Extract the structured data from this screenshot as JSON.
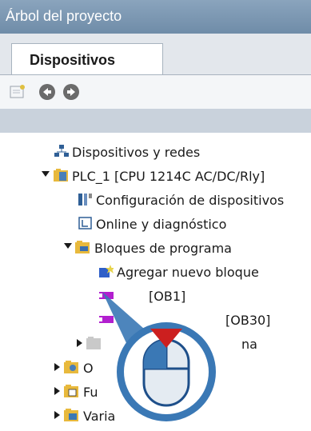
{
  "window": {
    "title": "Árbol del proyecto"
  },
  "tabs": [
    {
      "label": "Dispositivos"
    }
  ],
  "toolbar": {
    "icons": [
      "add-device-icon",
      "back-icon",
      "forward-icon"
    ]
  },
  "tree": {
    "items": [
      {
        "label": "Dispositivos y redes",
        "icon": "network-icon"
      },
      {
        "label": "PLC_1 [CPU 1214C AC/DC/Rly]",
        "icon": "plc-folder-icon"
      },
      {
        "label": "Configuración de dispositivos",
        "icon": "device-config-icon"
      },
      {
        "label": "Online y diagnóstico",
        "icon": "diagnostics-icon"
      },
      {
        "label": "Bloques de programa",
        "icon": "folder-icon"
      },
      {
        "label": "Agregar nuevo bloque",
        "icon": "add-block-icon"
      },
      {
        "label": "[OB1]",
        "icon": "ob-block-icon"
      },
      {
        "label": "[OB30]",
        "icon": "ob-block-icon"
      },
      {
        "label": "na",
        "icon": "folder-icon"
      },
      {
        "label": "O",
        "icon": "folder-icon"
      },
      {
        "label": "Fu",
        "icon": "folder-icon"
      },
      {
        "label": "Varia",
        "icon": "folder-icon"
      }
    ]
  },
  "colors": {
    "accent_red": "#cc1f1f",
    "cursor_blue": "#3a78b5"
  }
}
